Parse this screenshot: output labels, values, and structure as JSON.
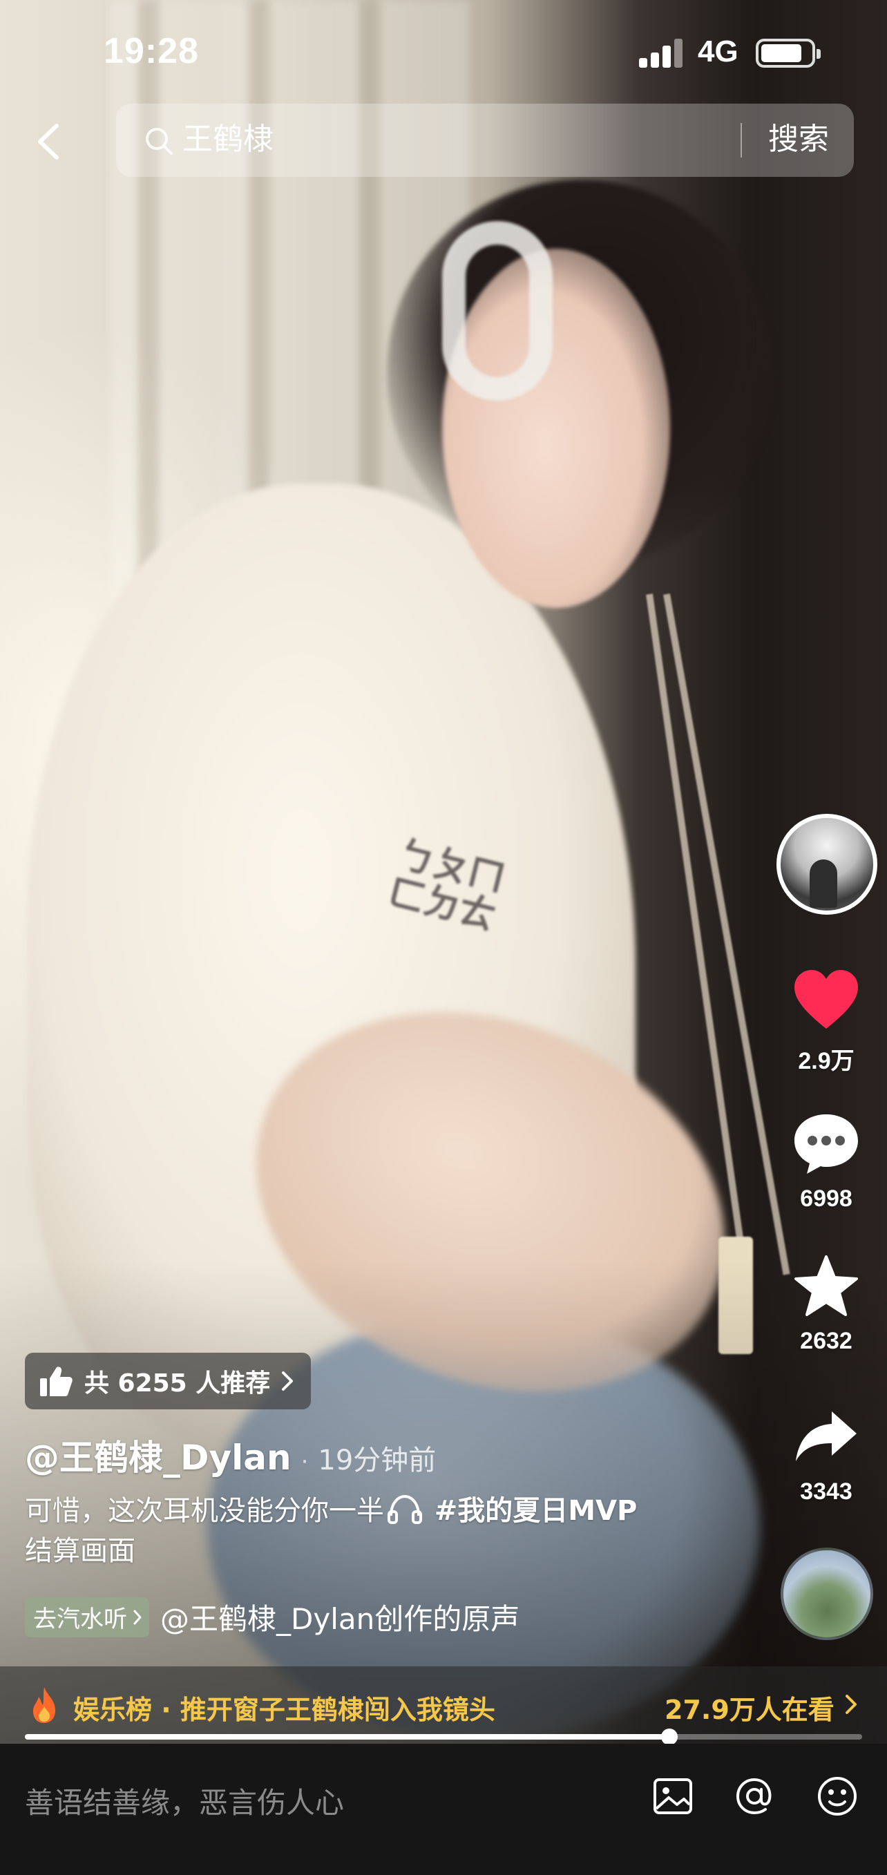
{
  "status_bar": {
    "time": "19:28",
    "network": "4G",
    "battery_level": 0.85
  },
  "search": {
    "query": "王鹤棣",
    "button_label": "搜索"
  },
  "rail": {
    "likes": "2.9万",
    "comments": "6998",
    "favorites": "2632",
    "shares": "3343"
  },
  "video": {
    "recommend_text": "共 6255 人推荐",
    "author": "@王鹤棣_Dylan",
    "time_ago": "19分钟前",
    "caption_text_before_icon": "可惜，这次耳机没能分你一半",
    "caption_hashtag": "#我的夏日MVP",
    "caption_line2": "结算画面",
    "listen_chip": "去汽水听",
    "music_title": "@王鹤棣_Dylan创作的原声",
    "progress": 0.77
  },
  "trend": {
    "label": "娱乐榜 · 推开窗子王鹤棣闯入我镜头",
    "viewers": "27.9万人在看"
  },
  "comment_bar": {
    "placeholder": "善语结善缘，恶言伤人心"
  },
  "colors": {
    "like_red": "#fe2c55",
    "trend_gold": "#f5c84b"
  }
}
